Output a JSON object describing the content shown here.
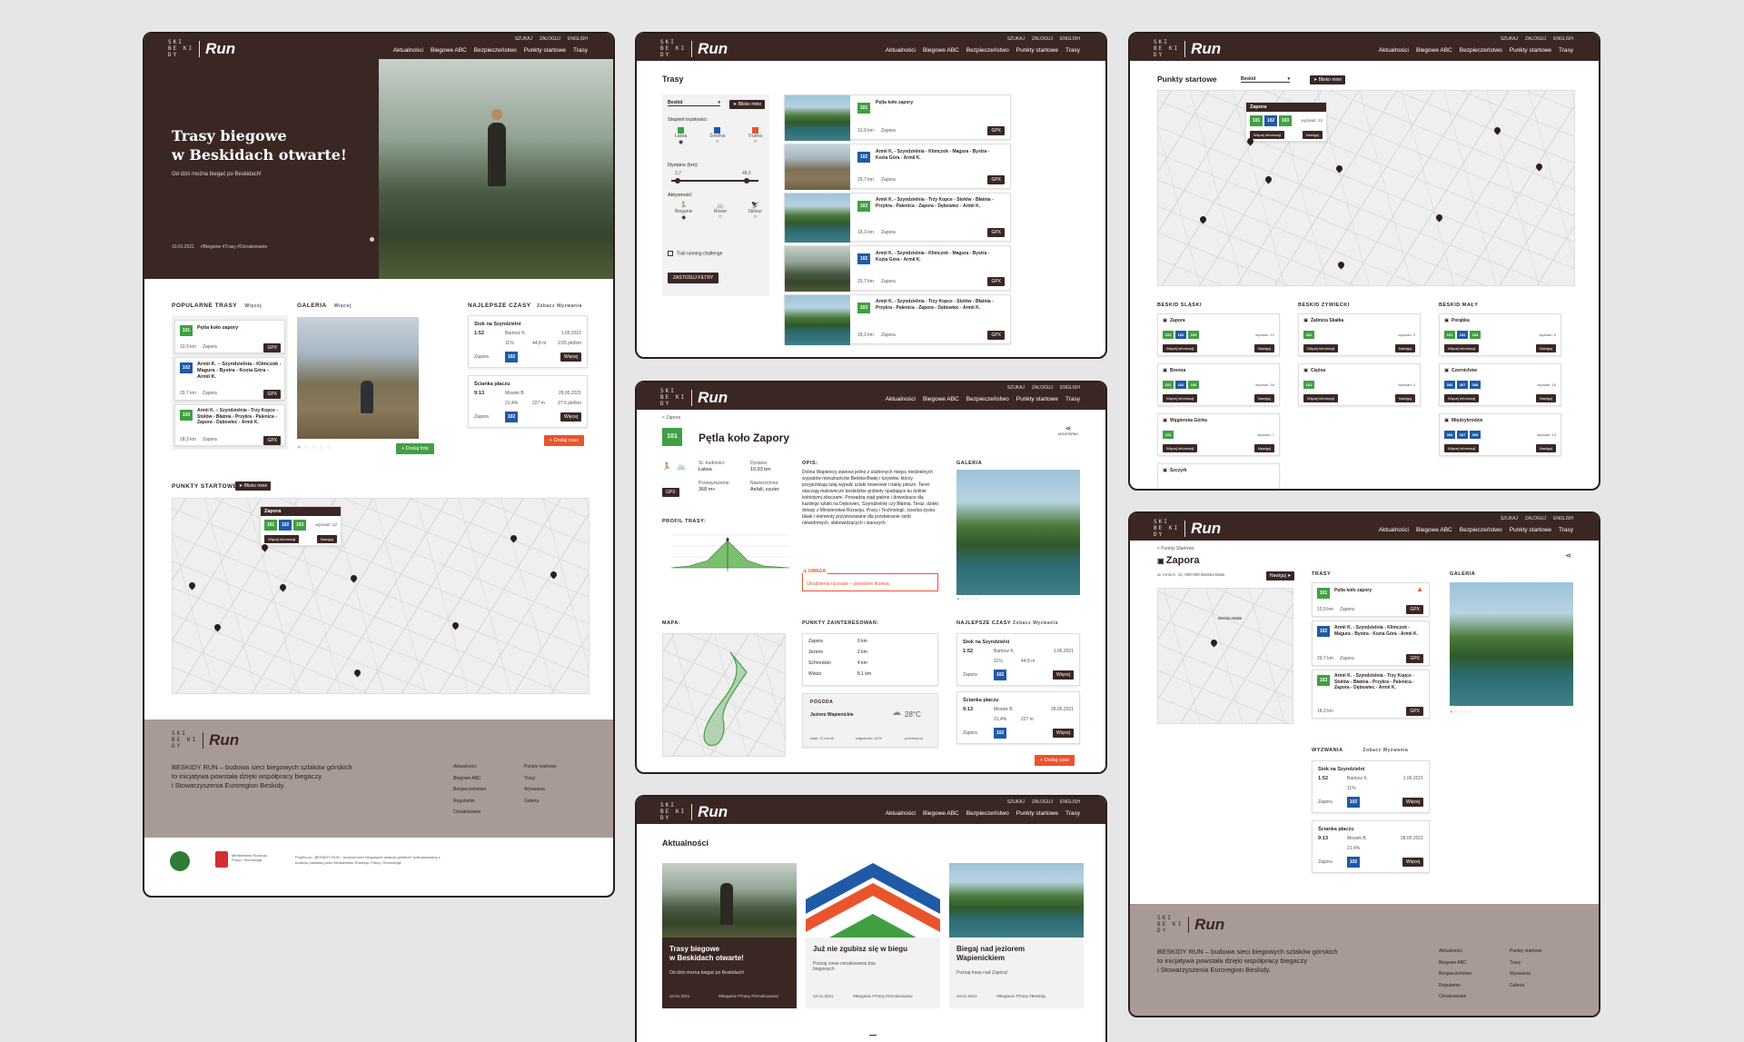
{
  "nav": {
    "util": [
      "SZUKAJ",
      "ZALOGUJ",
      "ENGLISH"
    ],
    "menu": [
      "Aktualności",
      "Biegowe ABC",
      "Bezpieczeństwo",
      "Punkty startowe",
      "Trasy"
    ],
    "brand": "Run",
    "mark": "SKI|BE|KI|DY"
  },
  "home": {
    "hero_title": "Trasy biegowe\nw Beskidach otwarte!",
    "hero_sub": "Od dziś można biegać po Beskidach!",
    "hero_date": "10.01.2021",
    "hero_tags": "#Bieganie #Trasy #Oznakowanie",
    "popular": "POPULARNE TRASY",
    "popular_more": "Więcej",
    "gallery": "GALERIA",
    "gallery_more": "Więcej",
    "best": "NAJLEPSZE CZASY",
    "best_more": "Zobacz Wyzwania",
    "routes": [
      {
        "n": "101",
        "c": "g",
        "name": "Pętla koło zapory",
        "km": "10,9 km",
        "start": "Zapora"
      },
      {
        "n": "102",
        "c": "b",
        "name": "Armii K. – Szyndzielnia - Klimczok - Magura - Bystra - Kozia Góra - Armii K.",
        "km": "29,7 km",
        "start": "Zapora"
      },
      {
        "n": "103",
        "c": "g",
        "name": "Armii K. – Szyndzielnia - Trzy Kopce - Stołów - Błatnia - Przykra - Palenica - Zapora - Dębowiec - Armii K.",
        "km": "18,3 km",
        "start": "Zapora"
      }
    ],
    "gpx": "GPX",
    "times": [
      {
        "name": "Stok na Szyndzielni",
        "t": "1:52",
        "who": "Bartosz K.",
        "date": "1.06.2021",
        "pct": "11%",
        "km": "44,8 m",
        "pace": "2:05 pkt/km",
        "start": "Zapora",
        "n": "102",
        "btn": "Więcej"
      },
      {
        "name": "Ścianka płaczu",
        "t": "9:13",
        "who": "Mosiek B.",
        "date": "28.05.2021",
        "pct": "21,4%",
        "km": "227 m",
        "pace": "27:6 pkt/km",
        "start": "Zapora",
        "n": "102",
        "btn": "Więcej"
      }
    ],
    "add_photo": "Dodaj fotę",
    "add_time": "Dodaj czas",
    "starts": "PUNKTY STARTOWE",
    "near": "Blisko mnie",
    "popup": {
      "name": "Zapora",
      "nums": [
        "101",
        "102",
        "103"
      ],
      "count": "wyzwań: 12",
      "more": "Więcej informacji",
      "nav": "Nawiguj"
    },
    "footer_text": "BESKIDY RUN – budowa sieci biegowych szlaków górskich\nto inicjatywa powstała dzięki współpracy biegaczy\ni Stowarzyszenia Euroregion Beskidy.",
    "footer_links1": [
      "Aktualności",
      "Biegowe ABC",
      "Bezpieczeństwo",
      "Regulamin",
      "Oznakowanie"
    ],
    "footer_links2": [
      "Punkty startowe",
      "Trasy",
      "Wyzwania",
      "Galeria"
    ],
    "footer_note": "Projekt pn. „BESKIDY RUN – budowa sieci biegowych szlaków górskich” dofinansowany z budżetu państwa przez Ministerstwo Rozwoju, Pracy i Technologii",
    "ministry": "Ministerstwo Rozwoju, Pracy i Technologii"
  },
  "trasy": {
    "title": "Trasy",
    "select": "Beskid",
    "near": "Blisko mnie",
    "diff": "Stopień trudności:",
    "levels": [
      "Łatwa",
      "Średnia",
      "Trudna"
    ],
    "dist": "Dystans (km):",
    "min": "3,7",
    "max": "48,5",
    "act": "Aktywność:",
    "acts": [
      "Bieganie",
      "Rower",
      "Skitour"
    ],
    "chk": "Trail running challenge",
    "apply": "ZASTOSUJ FILTRY",
    "list": [
      {
        "n": "101",
        "c": "g",
        "name": "Pętla koło zapory",
        "km": "10,9 km",
        "start": "Zapora"
      },
      {
        "n": "102",
        "c": "b",
        "name": "Armii K. - Szyndzielnia - Klimczok - Magura - Bystra - Kozia Góra - Armii K.",
        "km": "29,7 km",
        "start": "Zapora"
      },
      {
        "n": "103",
        "c": "g",
        "name": "Armii K. - Szyndzielnia - Trzy Kopce - Stołów - Błatnia - Przykra - Palenica - Zapora - Dębowiec - Armii K.",
        "km": "18,3 km",
        "start": "Zapora"
      },
      {
        "n": "102",
        "c": "b",
        "name": "Armii K. - Szyndzielnia - Klimczok - Magura - Bystra - Kozia Góra - Armii K.",
        "km": "29,7 km",
        "start": "Zapora"
      },
      {
        "n": "103",
        "c": "g",
        "name": "Armii K. - Szyndzielnia - Trzy Kopce - Stołów - Błatnia - Przykra - Palenica - Zapora - Dębowiec - Armii K.",
        "km": "18,3 km",
        "start": "Zapora"
      }
    ]
  },
  "punkty": {
    "title": "Punkty startowe",
    "select": "Beskid",
    "near": "Blisko mnie",
    "cols": [
      {
        "h": "BESKID ŚLĄSKI",
        "items": [
          {
            "name": "Zapora",
            "nums": [
              "101",
              "102",
              "103"
            ],
            "count": "wyzwań: 12"
          },
          {
            "name": "Brenna",
            "nums": [
              "101",
              "102",
              "106"
            ],
            "count": "wyzwań: 18"
          },
          {
            "name": "Węgierska Górka",
            "nums": [
              "101"
            ],
            "count": "wyzwań: 7"
          },
          {
            "name": "Szczyrk",
            "nums": [],
            "count": ""
          }
        ]
      },
      {
        "h": "BESKID ŻYWIECKI",
        "items": [
          {
            "name": "Żabnica Skałka",
            "nums": [
              "201"
            ],
            "count": "wyzwań: 3"
          },
          {
            "name": "Ciężna",
            "nums": [
              "101"
            ],
            "count": "wyzwań: 4"
          }
        ]
      },
      {
        "h": "BESKID MAŁY",
        "items": [
          {
            "name": "Porąbka",
            "nums": [
              "101",
              "102",
              "103"
            ],
            "count": "wyzwań: 9"
          },
          {
            "name": "Czernichów",
            "nums": [
              "306",
              "307",
              "308"
            ],
            "count": "wyzwań: 16"
          },
          {
            "name": "Międzybrodzie",
            "nums": [
              "306",
              "307",
              "309"
            ],
            "count": "wyzwań: 13"
          }
        ]
      }
    ],
    "more": "Więcej informacji",
    "nav": "Nawiguj"
  },
  "detail": {
    "crumb": "< Zapora",
    "n": "101",
    "title": "Pętla koło Zapory",
    "lvl_l": "St. trudności:",
    "lvl": "Łatwa",
    "dist_l": "Dystans:",
    "dist": "10,93 km",
    "up_l": "Przewyższenie:",
    "up": "368 m+",
    "surf_l": "Nawierzchnia:",
    "surf": "Asfalt, szuter",
    "desc_h": "OPIS:",
    "desc": "Dolina Wapienicy stanowi jedno z ulubionych miejsc niedzielnych wypadów mieszkańców Bielska-Białej i turystów, którzy przyjeżdżają tutaj wypalić szlaki rowerowe i trakty pieszo. Teren otaczają malownicze beskidzkie grzbiety opadające ku dolinie leśnistymi zboczami. Prowadzą stąd piękne i dowodzące dla każdego szlaki na Dębowiec, Szyndzielnię czy Błatnią. Teraz, dzięki dotacji z Ministerstwa Rozwoju, Pracy i Technologii, ścieżka zyska blask i elementy przystosowane dla przebieranie osób niewidomych, słabowidzących i starszych.",
    "gallery": "GALERIA",
    "profile": "PROFIL TRASY:",
    "warn_h": "UWAGA:",
    "warn": "Utrudnienia na trasie – powalone drzewa",
    "map": "MAPA:",
    "poi_h": "PUNKTY ZAINTERESOWAŃ:",
    "poi": [
      [
        "Zapora",
        "0 km"
      ],
      [
        "Jezioro",
        "2 km"
      ],
      [
        "Schronisko",
        "4 km"
      ],
      [
        "Wieża",
        "8,1 km"
      ]
    ],
    "weather_h": "POGODA",
    "weather_place": "Jezioro Wapienickie",
    "temp": "28°C",
    "wind": "wiatr: 9,1 km/h",
    "hum": "wilgotność: 41%",
    "cloud": "pochmurno",
    "best": "NAJLEPSZE CZASY",
    "best_more": "Zobacz Wyzwania",
    "add": "Dodaj czas",
    "share": "UDOSTĘPNIJ"
  },
  "news": {
    "title": "Aktualności",
    "items": [
      {
        "t": "Trasy biegowe\nw Beskidach otwarte!",
        "s": "Od dziś można biegać po Beskidach!",
        "d": "10.01.2021",
        "tags": "#Bieganie #Trasy #Oznakowanie"
      },
      {
        "t": "Już nie zgubisz się w biegu",
        "s": "Poznaj nowe oznakowania tras biegowych",
        "d": "10.01.2021",
        "tags": "#Bieganie #Trasy #Oznakowanie"
      },
      {
        "t": "Biegaj nad jeziorem\nWapienickiem",
        "s": "Poznaj trasę nad Zaporą!",
        "d": "10.01.2021",
        "tags": "#Bieganie #Trasy #Beskidy"
      }
    ]
  },
  "zapora": {
    "crumb": "< Punkty Startowe",
    "title": "Zapora",
    "addr": "ul. Armii K. 12, 000-000 Bielsko-Biała",
    "nav": "Nawiguj",
    "trasy": "TRASY",
    "gallery": "GALERIA",
    "challenges": "WYZWANIA",
    "ch_more": "Zobacz Wyzwania",
    "city": "Bielsko-Biała"
  }
}
